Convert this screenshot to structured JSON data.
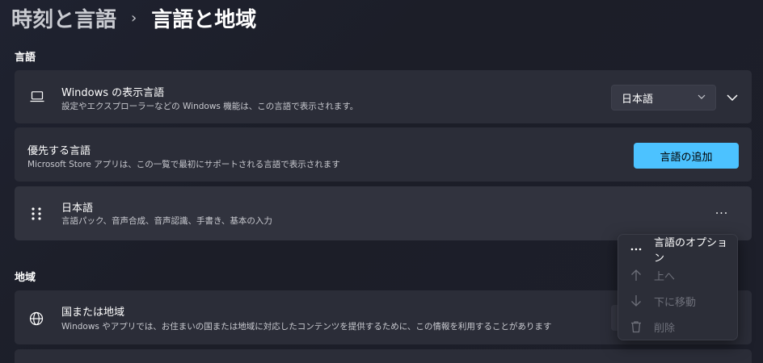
{
  "breadcrumb": {
    "parent": "時刻と言語",
    "separator": "›",
    "current": "言語と地域"
  },
  "language_section": {
    "label": "言語",
    "display_language": {
      "title": "Windows の表示言語",
      "subtitle": "設定やエクスプローラーなどの Windows 機能は、この言語で表示されます。",
      "selected_value": "日本語"
    },
    "preferred": {
      "title": "優先する言語",
      "subtitle": "Microsoft Store アプリは、この一覧で最初にサポートされる言語で表示されます",
      "add_button": "言語の追加"
    },
    "language_item": {
      "title": "日本語",
      "subtitle": "言語パック、音声合成、音声認識、手書き、基本の入力",
      "more_label": "···"
    }
  },
  "region_section": {
    "label": "地域",
    "country": {
      "title": "国または地域",
      "subtitle": "Windows やアプリでは、お住まいの国または地域に対応したコンテンツを提供するために、この情報を利用することがあります"
    }
  },
  "context_menu": {
    "items": [
      {
        "label": "言語のオプション",
        "icon": "more-icon",
        "enabled": true
      },
      {
        "label": "上へ",
        "icon": "arrow-up-icon",
        "enabled": false
      },
      {
        "label": "下に移動",
        "icon": "arrow-down-icon",
        "enabled": false
      },
      {
        "label": "削除",
        "icon": "trash-icon",
        "enabled": false
      }
    ]
  },
  "colors": {
    "accent": "#4cc2ff",
    "card": "#2b2d38",
    "background": "#1f2230",
    "disabled_text": "#6e707a"
  }
}
